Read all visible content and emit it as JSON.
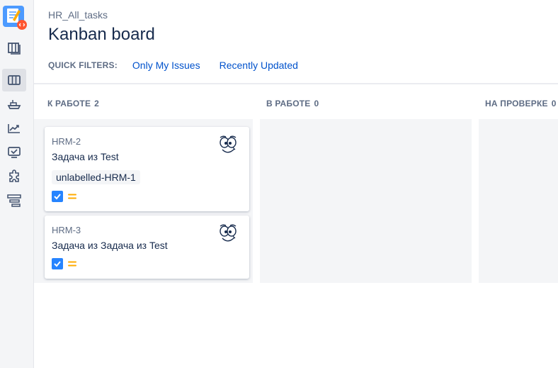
{
  "sidebar": {
    "items": [
      {
        "name": "project-logo-icon"
      },
      {
        "name": "backlog-icon"
      },
      {
        "name": "board-icon",
        "active": true
      },
      {
        "name": "releases-icon"
      },
      {
        "name": "reports-icon"
      },
      {
        "name": "issues-icon"
      },
      {
        "name": "components-icon"
      },
      {
        "name": "settings-icon"
      }
    ]
  },
  "header": {
    "breadcrumb": "HR_All_tasks",
    "title": "Kanban board"
  },
  "quick_filters": {
    "label": "QUICK FILTERS:",
    "filters": [
      "Only My Issues",
      "Recently Updated"
    ]
  },
  "columns": [
    {
      "title": "К РАБОТЕ",
      "count": "2",
      "cards": [
        {
          "key": "HRM-2",
          "summary": "Задача из Test",
          "label": "unlabelled-HRM-1",
          "type_icon": "task-checkbox-icon",
          "priority_icon": "priority-medium-icon"
        },
        {
          "key": "HRM-3",
          "summary": "Задача из Задача из Test",
          "type_icon": "task-checkbox-icon",
          "priority_icon": "priority-medium-icon"
        }
      ]
    },
    {
      "title": "В РАБОТЕ",
      "count": "0",
      "cards": []
    },
    {
      "title": "НА ПРОВЕРКЕ",
      "count": "0",
      "cards": []
    }
  ],
  "colors": {
    "link": "#0052cc",
    "task_type": "#2684ff",
    "priority_medium": "#ffab00",
    "column_bg": "#f4f5f7"
  }
}
